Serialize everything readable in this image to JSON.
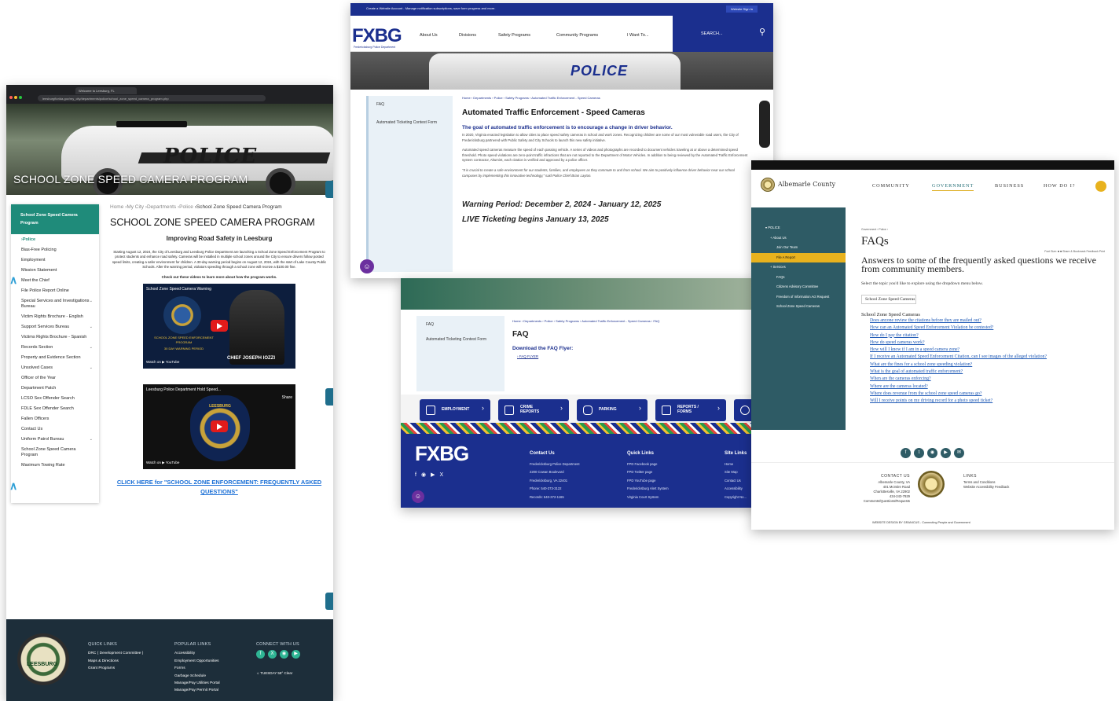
{
  "leesburg": {
    "browser_tab": "Welcome to Leesburg, FL",
    "browser_url": "leesburgflorida.gov/my_city/departments/police/school_zone_speed_camera_program.php",
    "hero_title": "SCHOOL ZONE SPEED CAMERA PROGRAM",
    "sidebar_title": "School Zone Speed Camera Program",
    "sidebar_items": [
      "›Police",
      "Bias-Free Policing",
      "Employment",
      "Mission Statement",
      "Meet the Chief",
      "File Police Report Online",
      "Special Services and Investigations Bureau",
      "Victim Rights Brochure - English",
      "Support Services Bureau",
      "Victims Rights Brochure - Spanish",
      "Records Section",
      "Property and Evidence Section",
      "Unsolved Cases",
      "Officer of the Year",
      "Department Patch",
      "LCSO Sex Offender Search",
      "FDLE Sex Offender Search",
      "Fallen Officers",
      "Contact Us",
      "Uniform Patrol Bureau",
      "School Zone Speed Camera Program",
      "Maximum Towing Rate"
    ],
    "breadcrumb": [
      "Home",
      "›My City",
      "›Departments",
      "›Police",
      "›School Zone Speed Camera Program"
    ],
    "page_title": "SCHOOL ZONE SPEED CAMERA PROGRAM",
    "subtitle": "Improving Road Safety in Leesburg",
    "intro": "Starting August 12, 2024, the City of Leesburg and Leesburg Police Department are launching a School Zone Speed Enforcement Program to protect students and enhance road safety. Cameras will be installed in multiple school zones around the City to ensure drivers follow posted speed limits, creating a safer environment for children. A 30-day warning period begins on August 12, 2024, with the start of Lake County Public Schools. After the warning period, violators speeding through a school zone will receive a $100.00 fine.",
    "videos_note": "Check out these videos to learn more about how the program works.",
    "video1_title": "School Zone Speed Camera Warning",
    "video1_text": "SCHOOL ZONE SPEED ENFORCEMENT PROGRAM",
    "video1_warning": "30 DAY WARNING PERIOD",
    "video1_chief": "CHIEF JOSEPH IOZZI",
    "video2_title": "Leesburg Police Department Hold Speed...",
    "video2_badge": "LEESBURG",
    "watch_on": "Watch on ▶ YouTube",
    "share": "Share",
    "faq_link": "CLICK HERE for \"SCHOOL ZONE ENFORCEMENT: FREQUENTLY ASKED QUESTIONS\"",
    "footer": {
      "seal_text": "LEESBURG",
      "quick_links_title": "QUICK LINKS",
      "quick_links": [
        "DRC ( Development Committee )",
        "Maps & Directions",
        "Grant Programs"
      ],
      "popular_links_title": "POPULAR LINKS",
      "popular_links": [
        "Accessibility",
        "Employment Opportunities",
        "Forms",
        "Garbage Schedule",
        "Manage/Pay Utilities Portal",
        "Manage/Pay Permit Portal"
      ],
      "connect_title": "CONNECT WITH US",
      "weather": "TUESDAY 58° Clear"
    }
  },
  "fredericksburg": {
    "top_bar": "Create a Website Account - Manage notification subscriptions, save form progress and more.",
    "sign_in": "Website Sign In",
    "logo": "FXBG",
    "logo_sub": "Fredericksburg Police Department",
    "nav": [
      "About Us",
      "Divisions",
      "Safety Programs",
      "Community Programs",
      "I Want To..."
    ],
    "search": "SEARCH...",
    "hero_word": "POLICE",
    "sidebar": [
      "FAQ",
      "Automated Ticketing Contest Form"
    ],
    "breadcrumb": "Home › Departments › Police › Safety Programs › Automated Traffic Enforcement - Speed Cameras",
    "title": "Automated Traffic Enforcement - Speed Cameras",
    "goal": "The goal of automated traffic enforcement is to encourage a change in driver behavior.",
    "p1": "In 2020, Virginia enacted legislation to allow cities to place speed safety cameras in school and work zones. Recognizing children are some of our most vulnerable road users, the City of Fredericksburg partnered with Public Safety and City Schools to launch this new safety initiative.",
    "p2": "Automated speed cameras measure the speed of each passing vehicle. A series of videos and photographs are recorded to document vehicles traveling at or above a determined speed threshold. Photo speed violations are zero-point traffic infractions that are not reported to the Department of Motor Vehicles. In addition to being reviewed by the Automated Traffic Enforcement system contractor, Altumint, each citation is verified and approved by a police officer.",
    "quote": "\"It is crucial to create a safe environment for our students, families, and employees as they commute to and from school. We aim to positively influence driver behavior near our school campuses by implementing this innovative technology,\" said Police Chief Brian Layton.",
    "warning": "Warning Period: December 2, 2024 - January 12, 2025",
    "live": "LIVE Ticketing begins January 13, 2025"
  },
  "fxbg_faq": {
    "sidebar": [
      "FAQ",
      "Automated Ticketing Contest Form"
    ],
    "breadcrumb": "Home › Departments › Police › Safety Programs › Automated Traffic Enforcement - Speed Cameras › FAQ",
    "title": "FAQ",
    "download": "Download the FAQ Flyer:",
    "flyer": "FAQ FLYER",
    "quick": [
      "EMPLOYMENT",
      "CRIME REPORTS",
      "PARKING",
      "REPORTS / FORMS"
    ],
    "footer_logo": "FXBG",
    "contact_title": "Contact Us",
    "contact": [
      "Fredericksburg Police Department",
      "2200 Cowan Boulevard",
      "Fredericksburg, VA 22401",
      "Phone: 540-373-3122",
      "Records: 540-372-1165"
    ],
    "quick_title": "Quick Links",
    "quick_links": [
      "FPD Facebook page",
      "FPD Twitter page",
      "FPD YouTube page",
      "Fredericksburg Alert System",
      "Virginia Court System"
    ],
    "site_title": "Site Links",
    "site_links": [
      "Home",
      "Site Map",
      "Contact Us",
      "Accessibility",
      "Copyright No..."
    ]
  },
  "albemarle": {
    "name": "Albemarle County",
    "nav": [
      "COMMUNITY",
      "GOVERNMENT",
      "BUSINESS",
      "HOW DO I?"
    ],
    "sidebar": [
      "POLICE",
      "About Us",
      "Join Our Team",
      "File A Report",
      "Services",
      "FAQs",
      "Citizens Advisory Committee",
      "Freedom of Information Act Request",
      "School Zone Speed Cameras"
    ],
    "breadcrumb": "Government › Police ›",
    "title": "FAQs",
    "tools": "Font Size: ■ ■   Share & Bookmark   Feedback   Print",
    "answers": "Answers to some of the frequently asked questions we receive from community members.",
    "select_label": "Select the topic you'd like to explore using the dropdown menu below.",
    "select_value": "School Zone Speed Cameras",
    "list_heading": "School Zone Speed Cameras",
    "questions": [
      "Does anyone review the citations before they are mailed out?",
      "How can an Automated Speed Enforcement Violation be contested?",
      "How do I pay the citation?",
      "How do speed cameras work?",
      "How will I know if I am in a speed camera zone?",
      "If I receive an Automated Speed Enforcement Citation, can I see images of the alleged violation?",
      "What are the fines for a school zone speeding violation?",
      "What is the goal of automated traffic enforcement?",
      "When are the cameras enforcing?",
      "Where are the cameras located?",
      "Where does revenue from the school zone speed cameras go?",
      "Will I receive points on my driving record for a photo speed ticket?"
    ],
    "contact_title": "CONTACT US",
    "contact": [
      "Albemarle County, VA",
      "401 McIntire Road",
      "Charlottesville, VA 22902",
      "434-243-7929",
      "Comments/Questions/Requests"
    ],
    "links_title": "LINKS",
    "links": [
      "Terms and Conditions",
      "Website Accessibility Feedback"
    ],
    "design": "WEBSITE DESIGN BY GRANICUS - Connecting People and Government"
  },
  "colors": {
    "leesburg_teal": "#1f8b7a",
    "leesburg_footer": "#1d2e3a",
    "fxbg_blue": "#1b2f8e",
    "albemarle_teal": "#2e5b65",
    "albemarle_gold": "#e8b21e",
    "link_blue": "#1a56b4"
  }
}
